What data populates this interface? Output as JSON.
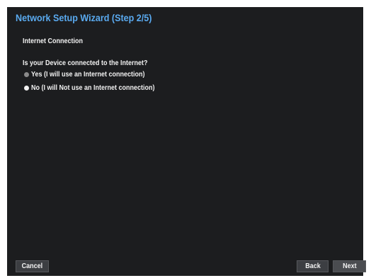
{
  "wizard": {
    "title": "Network Setup Wizard (Step 2/5)",
    "section_label": "Internet Connection",
    "question": "Is your Device connected to the Internet?",
    "options": [
      {
        "label": "Yes (I will use an Internet connection)",
        "selected": false
      },
      {
        "label": "No (I will Not use an Internet connection)",
        "selected": true
      }
    ]
  },
  "footer": {
    "cancel_label": "Cancel",
    "back_label": "Back",
    "next_label": "Next"
  },
  "colors": {
    "title": "#5aaaf0",
    "background": "#1c1d1f",
    "text": "#f2f2f2",
    "button": "#3c3e42"
  }
}
